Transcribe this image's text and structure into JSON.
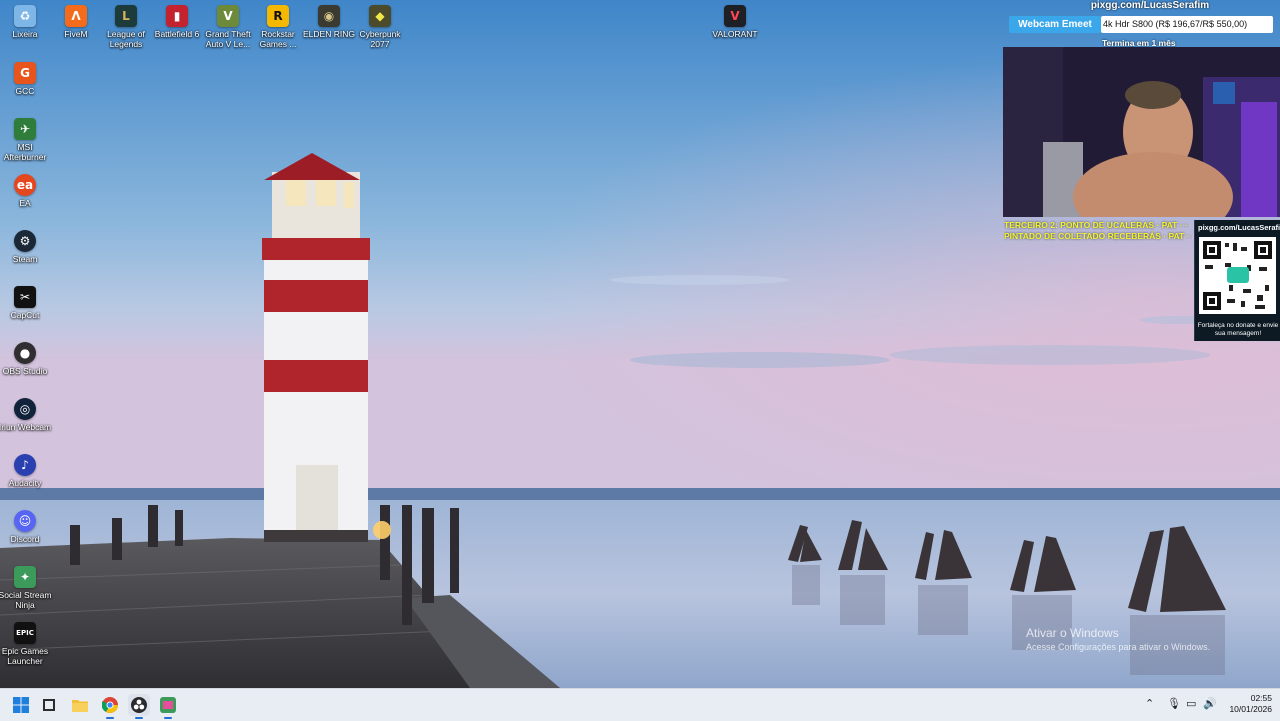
{
  "desktop_icons": [
    {
      "label": "Lixeira",
      "icon": "recycle-bin-icon"
    },
    {
      "label": "FiveM",
      "icon": "fivem-icon"
    },
    {
      "label": "League of Legends",
      "icon": "league-of-legends-icon"
    },
    {
      "label": "Battlefield 6",
      "icon": "battlefield-icon"
    },
    {
      "label": "Grand Theft Auto V Le...",
      "icon": "gta-icon"
    },
    {
      "label": "Rockstar Games ...",
      "icon": "rockstar-icon"
    },
    {
      "label": "ELDEN RING",
      "icon": "elden-ring-icon"
    },
    {
      "label": "Cyberpunk 2077",
      "icon": "cyberpunk-icon"
    },
    {
      "label": "VALORANT",
      "icon": "valorant-icon"
    },
    {
      "label": "GCC",
      "icon": "gcc-icon"
    },
    {
      "label": "MSI Afterburner",
      "icon": "msi-afterburner-icon"
    },
    {
      "label": "EA",
      "icon": "ea-icon"
    },
    {
      "label": "Steam",
      "icon": "steam-icon"
    },
    {
      "label": "CapCut",
      "icon": "capcut-icon"
    },
    {
      "label": "OBS Studio",
      "icon": "obs-icon"
    },
    {
      "label": "Iriun Webcam",
      "icon": "iriun-icon"
    },
    {
      "label": "Audacity",
      "icon": "audacity-icon"
    },
    {
      "label": "Discord",
      "icon": "discord-icon"
    },
    {
      "label": "Social Stream Ninja",
      "icon": "social-stream-icon"
    },
    {
      "label": "Epic Games Launcher",
      "icon": "epic-games-icon"
    }
  ],
  "overlay": {
    "top_url": "pixgg.com/LucasSerafim",
    "webcam_label": "Webcam Emeet",
    "donation_text": "4k Hdr S800 (R$ 196,67/R$ 550,00)",
    "ends_label": "Termina em 1 mês",
    "qr_url": "pixgg.com/LucasSerafim",
    "qr_caption": "Fortaleça no donate e envie sua mensagem!",
    "ticker_line1": "TERCEIRO 2: PONTO DE UCALERAS · PAT · ·",
    "ticker_line2": "PINTADO DE COLETADO RECEBERÁS · PAT · ·"
  },
  "watermark": {
    "title": "Ativar o Windows",
    "subtitle": "Acesse Configurações para ativar o Windows."
  },
  "taskbar": {
    "apps": [
      "start-icon",
      "task-view-icon",
      "file-explorer-icon",
      "chrome-icon",
      "obs-icon",
      "social-stream-icon"
    ],
    "clock_time": "02:55",
    "clock_date": "10/01/2026"
  },
  "colors": {
    "taskbar_bg": "#e8ecf3",
    "webcam_bar": "#3aa7ea",
    "ticker_text": "#f2f230"
  }
}
